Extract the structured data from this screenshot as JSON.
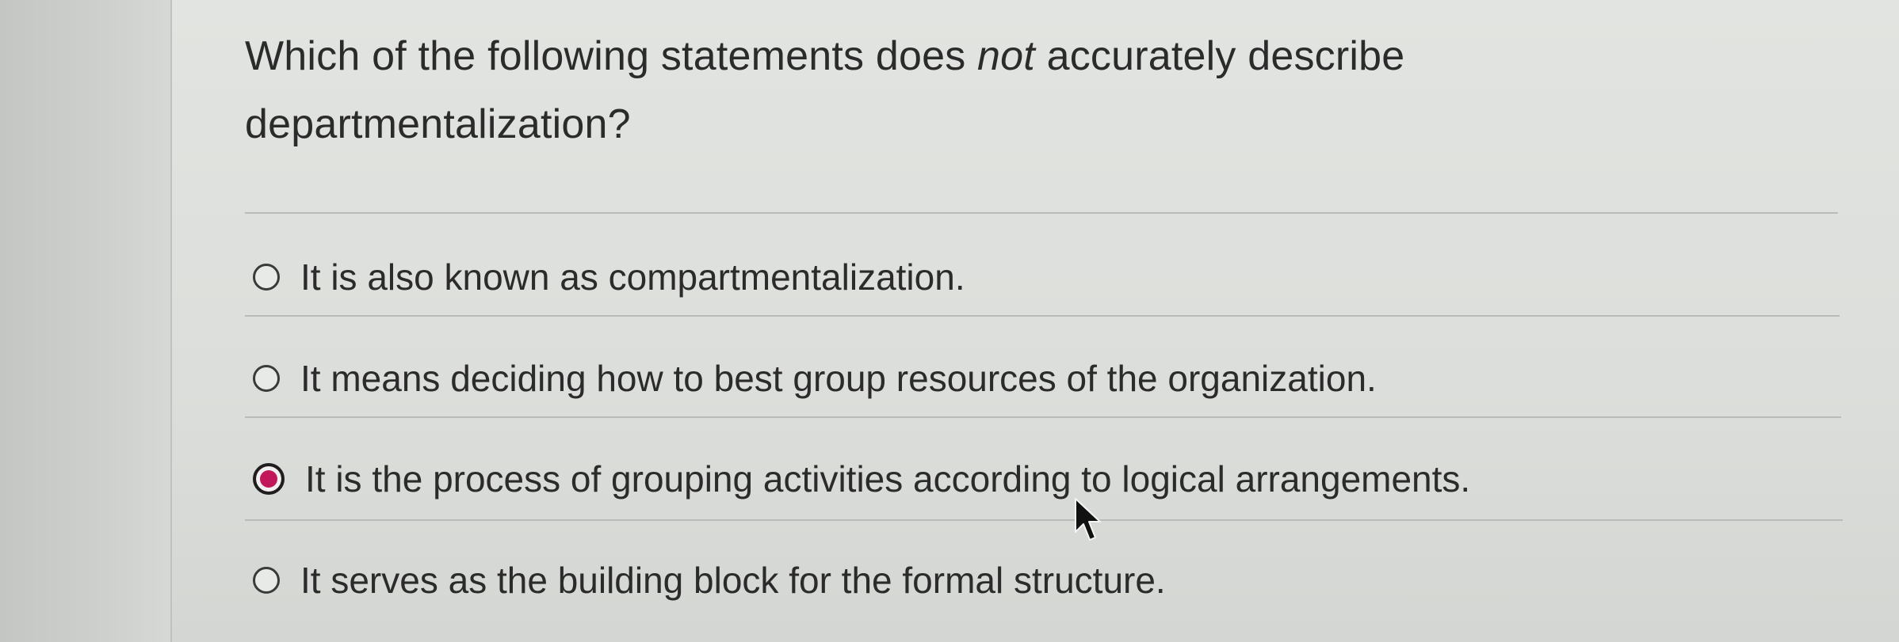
{
  "question": {
    "text_before": "Which of the following statements does ",
    "emphasis": "not",
    "text_after": " accurately describe departmentalization?"
  },
  "options": [
    {
      "label": "It is also known as compartmentalization.",
      "selected": false
    },
    {
      "label": "It means deciding how to best group resources of the organization.",
      "selected": false
    },
    {
      "label": "It is the process of grouping activities according to logical arrangements.",
      "selected": true
    },
    {
      "label": "It serves as the building block for the formal structure.",
      "selected": false
    }
  ],
  "colors": {
    "selected_radio": "#c2185b",
    "text": "#2b2b2b"
  },
  "cursor": {
    "icon": "mouse-pointer-icon"
  }
}
